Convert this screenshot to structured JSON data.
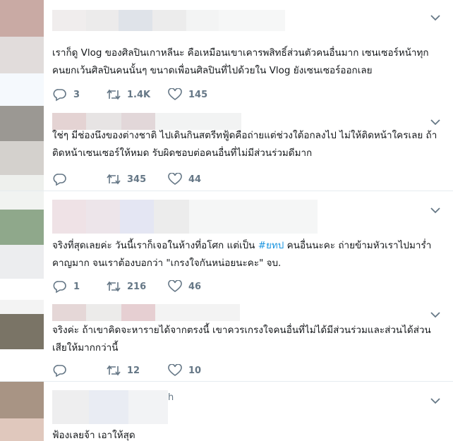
{
  "tweets": [
    {
      "text": "เราก็ดู Vlog ของศิลปินเกาหลีนะ คือเหมือนเขาเคารพสิทธิ์ส่วนตัวคนอื่นมาก เซนเซอร์หน้าทุกคนยกเว้นศิลปินคนนั้นๆ ขนาดเพื่อนศิลปินที่ไปด้วยใน Vlog ยังเซนเซอร์ออกเลย",
      "replies": "3",
      "retweets": "1.4K",
      "likes": "145"
    },
    {
      "text": "ใช่ๆ มีช่องนึงของต่างชาติ ไปเดินกินสตรีทฟู้ดคือถ่ายแต่ช่วงใต้อกลงไป ไม่ให้ติดหน้าใครเลย ถ้าติดหน้าเซนเซอร์ให้หมด รับผิดชอบต่อคนอื่นที่ไม่มีส่วนร่วมดีมาก",
      "replies": "",
      "retweets": "345",
      "likes": "44"
    },
    {
      "text_before": "จริงที่สุดเลยค่ะ วันนี้เราก็เจอในห้างที่อโศก แต่เป็น ",
      "hashtag": "#ยทป",
      "text_after": " คนอื่นนะคะ ถ่ายข้ามหัวเราไปมาร่ำคาญมาก จนเราต้องบอกว่า \"เกรงใจกันหน่อยนะคะ\" จบ.",
      "replies": "1",
      "retweets": "216",
      "likes": "46"
    },
    {
      "text": "จริงค่ะ ถ้าเขาคิดจะหารายได้จากตรงนี้ เขาควรเกรงใจคนอื่นที่ไม่ได้มีส่วนร่วมและส่วนได้ส่วนเสียให้มากกว่านี้",
      "replies": "",
      "retweets": "12",
      "likes": "10"
    },
    {
      "header_fragment": "h",
      "text": "ฟ้องเลยจ้า เอาให้สุด"
    }
  ],
  "icons": {
    "reply": "reply-icon",
    "retweet": "retweet-icon",
    "like": "heart-icon",
    "menu": "chevron-down-icon"
  },
  "colors": {
    "text": "#14171a",
    "muted": "#657786",
    "hashtag": "#1b95e0",
    "border": "#e6ecf0"
  }
}
